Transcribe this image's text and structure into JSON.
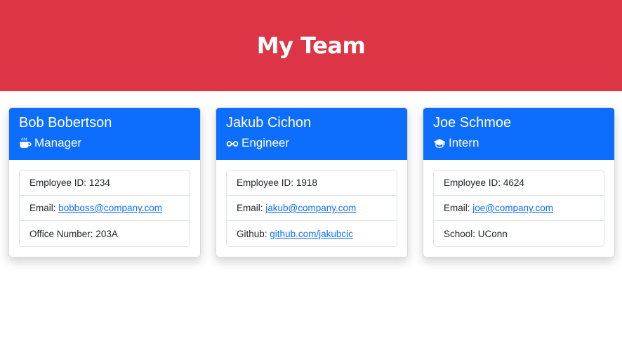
{
  "header": {
    "title": "My Team"
  },
  "cards": [
    {
      "name": "Bob Bobertson",
      "role": "Manager",
      "icon": "coffee-icon",
      "id_label": "Employee ID: ",
      "id": "1234",
      "email_label": "Email: ",
      "email": "bobboss@company.com",
      "extra_label": "Office Number: ",
      "extra": "203A"
    },
    {
      "name": "Jakub Cichon",
      "role": "Engineer",
      "icon": "glasses-icon",
      "id_label": "Employee ID: ",
      "id": "1918",
      "email_label": "Email: ",
      "email": "jakub@company.com",
      "extra_label": "Github: ",
      "extra": "github.com/jakubcic"
    },
    {
      "name": "Joe Schmoe",
      "role": "Intern",
      "icon": "graduation-cap-icon",
      "id_label": "Employee ID: ",
      "id": "4624",
      "email_label": "Email: ",
      "email": "joe@company.com",
      "extra_label": "School: ",
      "extra": "UConn"
    }
  ],
  "colors": {
    "header_bg": "#dc3545",
    "card_header_bg": "#0d6efd",
    "link": "#0d6efd"
  }
}
